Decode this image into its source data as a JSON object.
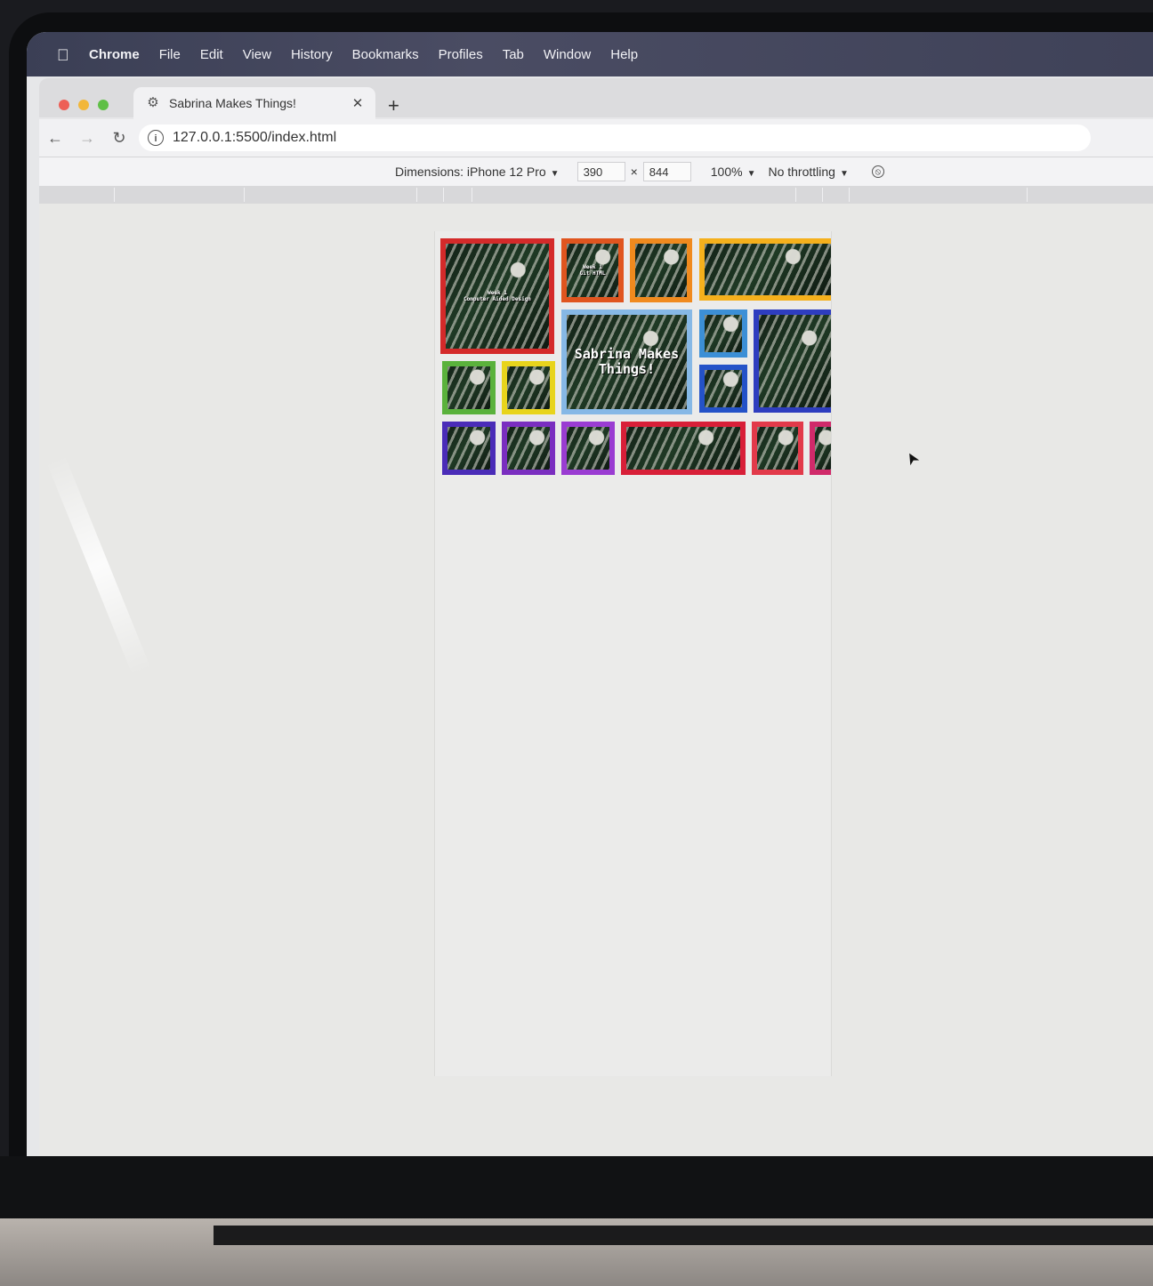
{
  "menubar": {
    "items": [
      "Chrome",
      "File",
      "Edit",
      "View",
      "History",
      "Bookmarks",
      "Profiles",
      "Tab",
      "Window",
      "Help"
    ]
  },
  "tab": {
    "title": "Sabrina Makes Things!",
    "close": "✕",
    "new": "+"
  },
  "toolbar": {
    "url": "127.0.0.1:5500/index.html",
    "back": "←",
    "forward": "→",
    "reload": "↻"
  },
  "devtools": {
    "dimensions_label": "Dimensions: iPhone 12 Pro",
    "width": "390",
    "height": "844",
    "times": "×",
    "zoom": "100%",
    "throttling": "No throttling"
  },
  "page": {
    "tiles": [
      {
        "label": "Week 1\nComputer Aided Design",
        "color": "#d42a2a"
      },
      {
        "label": "Week 1\nGit HTML",
        "color": "#e0551f"
      },
      {
        "label": "",
        "color": "#f08a1e"
      },
      {
        "label": "",
        "color": "#f5b01c"
      },
      {
        "label": "Sabrina Makes Things!",
        "color": "#86b8e6"
      },
      {
        "label": "",
        "color": "#3c8fd6"
      },
      {
        "label": "",
        "color": "#2452c8"
      },
      {
        "label": "",
        "color": "#2e3dbf"
      },
      {
        "label": "",
        "color": "#5ab23c"
      },
      {
        "label": "",
        "color": "#e8d41c"
      },
      {
        "label": "",
        "color": "#4a2cb8"
      },
      {
        "label": "",
        "color": "#7a2ec0"
      },
      {
        "label": "",
        "color": "#9a3cd2"
      },
      {
        "label": "",
        "color": "#d81f38"
      },
      {
        "label": "",
        "color": "#e23a4a"
      },
      {
        "label": "",
        "color": "#d02a6a"
      }
    ]
  }
}
